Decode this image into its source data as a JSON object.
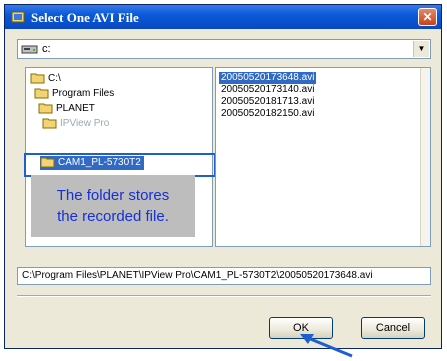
{
  "window": {
    "title": "Select One AVI File",
    "close_glyph": "✕"
  },
  "drive": {
    "value": "c:",
    "arrow_glyph": "▼"
  },
  "folders": {
    "items": [
      {
        "label": "C:\\"
      },
      {
        "label": "Program Files"
      },
      {
        "label": "PLANET"
      },
      {
        "label": "IPView Pro"
      },
      {
        "label": "CAM1_PL-5730T2"
      }
    ],
    "selected_index": 4
  },
  "files": {
    "items": [
      {
        "label": "20050520173648.avi"
      },
      {
        "label": "20050520173140.avi"
      },
      {
        "label": "20050520181713.avi"
      },
      {
        "label": "20050520182150.avi"
      }
    ],
    "selected_index": 0
  },
  "callout": {
    "line1": "The folder stores",
    "line2": "the recorded file."
  },
  "path": {
    "value": "C:\\Program Files\\PLANET\\IPView Pro\\CAM1_PL-5730T2\\20050520173648.avi"
  },
  "buttons": {
    "ok_label": "OK",
    "cancel_label": "Cancel"
  },
  "colors": {
    "highlight": "#1e5fd0",
    "selection": "#316ac5",
    "callout_text": "#1430d8",
    "callout_bg": "#bdbdbd"
  },
  "icons": {
    "app": "video-file-icon",
    "drive": "drive-icon",
    "folder": "folder-icon",
    "arrow": "pointer-arrow"
  }
}
